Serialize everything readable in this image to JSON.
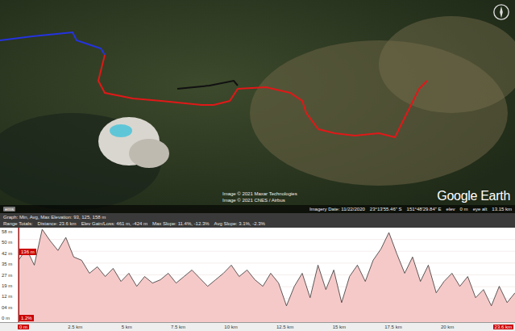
{
  "map": {
    "attribution": [
      "Image © 2021 Maxar Technologies",
      "Image © 2021 CNES / Airbus"
    ],
    "logo": "Google Earth",
    "badge": "ems",
    "status": [
      {
        "label": "Imagery Date: 11/22/2020"
      },
      {
        "label": "23°13'55.46\" S"
      },
      {
        "label": "151°48'29.84\" E"
      },
      {
        "label": "elev"
      },
      {
        "label": "0 m"
      },
      {
        "label": "eye alt"
      },
      {
        "label": "13.15 km"
      }
    ]
  },
  "profile": {
    "header": "Graph: Min, Avg, Max Elevation: 93, 125, 158 m",
    "totals": [
      "Range Totals:",
      "Distance: 23.6 km",
      "Elev Gain/Loss: 461 m, -424 m",
      "Max Slope: 11.4%, -12.3%",
      "Avg Slope: 3.1%, -2.3%"
    ],
    "y_ticks": [
      "58 m",
      "50 m",
      "42 m",
      "35 m",
      "27 m",
      "19 m",
      "12 m",
      "04 m",
      "0 m"
    ],
    "x_ticks": [
      "0 m",
      "2.5 km",
      "5 km",
      "7.5 km",
      "10 km",
      "12.5 km",
      "15 km",
      "17.5 km",
      "20 km",
      "23.6 km"
    ],
    "cursor_elevation": "136 m",
    "cursor_slope": "1.2%",
    "series": [
      {
        "name": "elevation",
        "values": [
          38,
          45,
          35,
          57,
          50,
          44,
          52,
          40,
          38,
          30,
          34,
          28,
          33,
          25,
          30,
          22,
          28,
          24,
          26,
          30,
          24,
          28,
          32,
          27,
          22,
          26,
          30,
          35,
          28,
          32,
          26,
          22,
          30,
          24,
          10,
          22,
          30,
          15,
          35,
          20,
          32,
          12,
          28,
          35,
          25,
          38,
          45,
          55,
          42,
          30,
          40,
          25,
          35,
          18,
          25,
          30,
          22,
          28,
          15,
          20,
          10,
          22,
          12,
          18
        ]
      }
    ]
  }
}
